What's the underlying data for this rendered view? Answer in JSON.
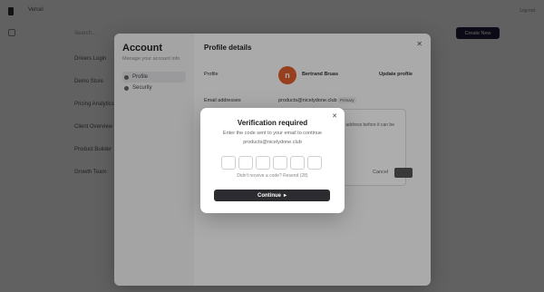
{
  "app": {
    "nav_title": "Vercel",
    "top_right": "Log out",
    "search_placeholder": "Search...",
    "cta_label": "Create New",
    "list_items": [
      "Drivers Login",
      "Demo Store",
      "Pricing Analytics",
      "Client Overview",
      "Product Builder",
      "Growth Team"
    ]
  },
  "account": {
    "title": "Account",
    "subtitle": "Manage your account info",
    "nav": [
      {
        "label": "Profile",
        "active": true
      },
      {
        "label": "Security",
        "active": false
      }
    ],
    "main_title": "Profile details",
    "profile_label": "Profile",
    "profile_name": "Bertrand Bruas",
    "avatar_letter": "n",
    "update_profile": "Update profile",
    "email_label": "Email addresses",
    "email_value": "products@nicelydone.club",
    "primary_badge": "Primary",
    "card_text": "r address before it can be",
    "card_cancel": "Cancel"
  },
  "dialog": {
    "title": "Verification required",
    "desc_line1": "Enter the code sent to your email to continue",
    "desc_line2": "products@nicelydone.club",
    "code_length": 6,
    "resend": "Didn't receive a code? Resend (28)",
    "continue_label": "Continue",
    "continue_icon": "arrow-right-icon",
    "close_icon": "close-icon"
  }
}
